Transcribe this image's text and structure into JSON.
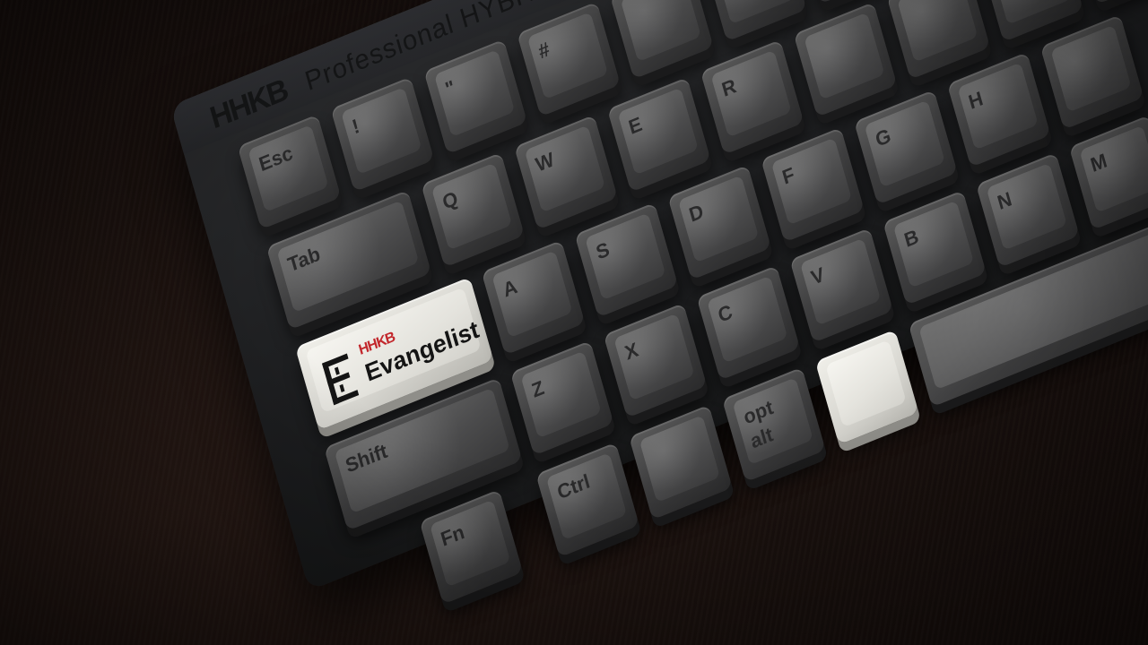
{
  "photo": {
    "brand_logo": "HHKB",
    "brand_text": "Professional HYBRID",
    "evangelist_key": {
      "logo": "HHKB",
      "text": "Evangelist"
    },
    "key_legends": [
      "Esc",
      "!",
      "\"",
      "#",
      "Q",
      "W",
      "E",
      "R",
      "Tab",
      "A",
      "S",
      "D",
      "F",
      "G",
      "H",
      "Shift",
      "Z",
      "X",
      "C",
      "V",
      "B",
      "N",
      "M",
      "Fn",
      "opt",
      "alt",
      "Ctrl"
    ],
    "colors": {
      "desk": "#1b1210",
      "case": "#26272a",
      "dark_key": "#4b4b4c",
      "white_key": "#e4e3dd",
      "logo_red": "#c2262b"
    }
  }
}
